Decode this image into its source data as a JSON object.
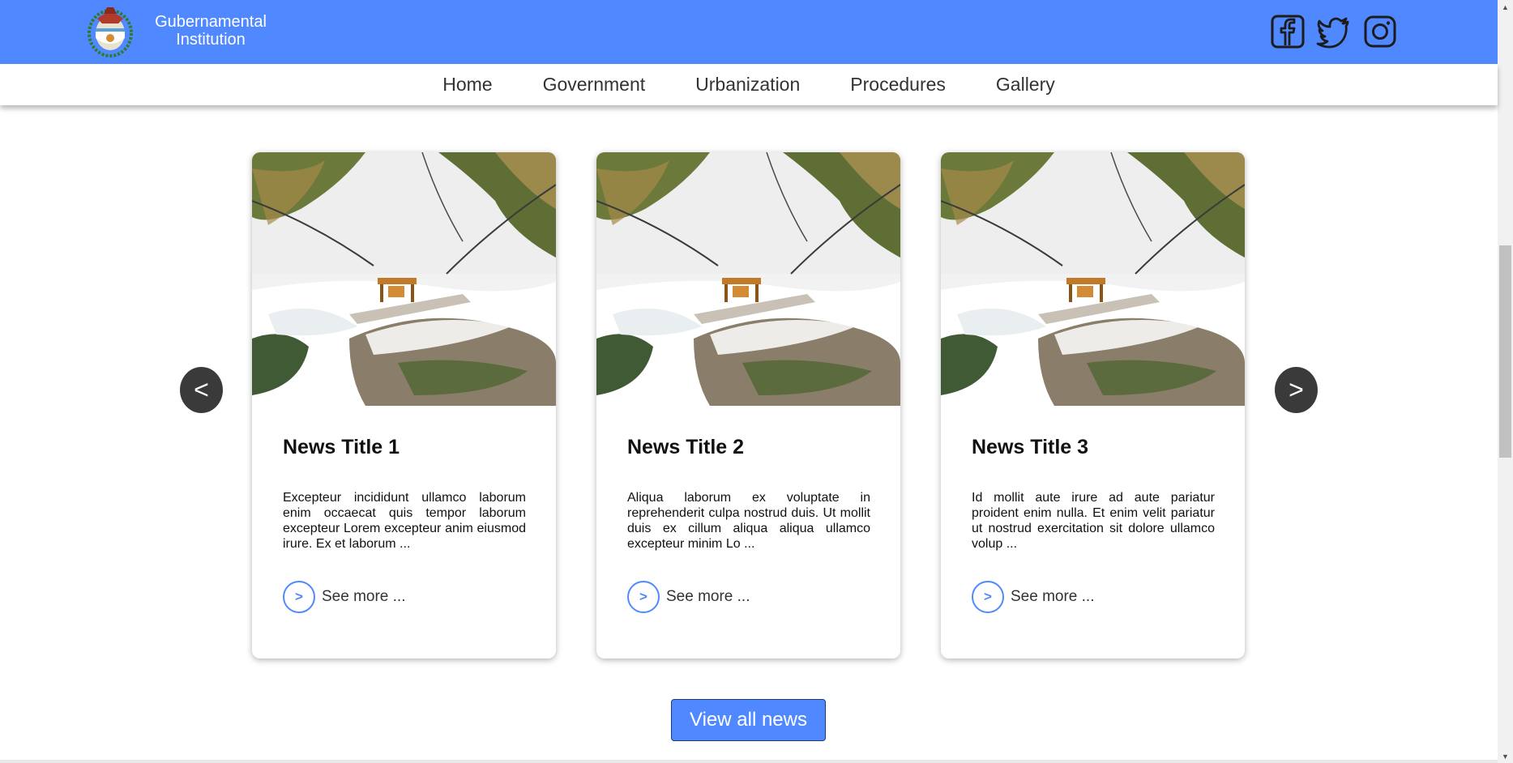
{
  "colors": {
    "accent": "#5089ff",
    "arrow": "#3a3a3a"
  },
  "header": {
    "brand_line1": "Gubernamental",
    "brand_line2": "Institution",
    "logo_icon": "coat-of-arms-icon",
    "social": [
      "facebook-icon",
      "twitter-icon",
      "instagram-icon"
    ]
  },
  "nav": {
    "items": [
      {
        "label": "Home"
      },
      {
        "label": "Government"
      },
      {
        "label": "Urbanization"
      },
      {
        "label": "Procedures"
      },
      {
        "label": "Gallery"
      }
    ]
  },
  "carousel": {
    "prev_label": "<",
    "next_label": ">",
    "cards": [
      {
        "title": "News Title 1",
        "text": "Excepteur incididunt ullamco laborum enim occaecat quis tempor laborum excepteur Lorem excepteur anim eiusmod irure. Ex et laborum ...",
        "more_symbol": ">",
        "more_label": "See more ..."
      },
      {
        "title": "News Title 2",
        "text": "Aliqua laborum ex voluptate in reprehenderit culpa nostrud duis. Ut mollit duis ex cillum aliqua aliqua ullamco excepteur minim Lo ...",
        "more_symbol": ">",
        "more_label": "See more ..."
      },
      {
        "title": "News Title 3",
        "text": "Id mollit aute irure ad aute pariatur proident enim nulla. Et enim velit pariatur ut nostrud exercitation sit dolore ullamco volup ...",
        "more_symbol": ">",
        "more_label": "See more ..."
      }
    ]
  },
  "view_all_label": "View all news"
}
